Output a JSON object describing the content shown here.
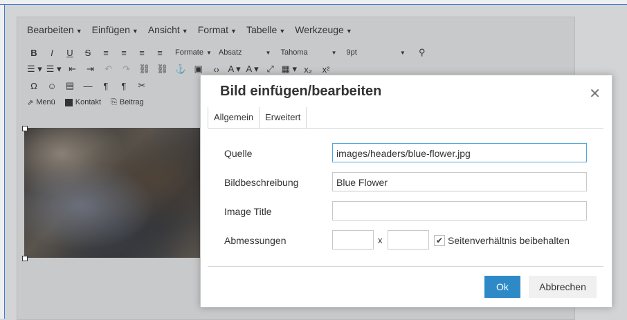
{
  "menubar": {
    "items": [
      "Bearbeiten",
      "Einfügen",
      "Ansicht",
      "Format",
      "Tabelle",
      "Werkzeuge"
    ]
  },
  "toolbar": {
    "bold": "B",
    "italic": "I",
    "underline": "U",
    "strike": "S",
    "formats_label": "Formate",
    "paragraph_label": "Absatz",
    "font_label": "Tahoma",
    "size_label": "9pt",
    "link_menu": "Menü",
    "link_contact": "Kontakt",
    "link_post": "Beitrag"
  },
  "dialog": {
    "title": "Bild einfügen/bearbeiten",
    "tabs": [
      "Allgemein",
      "Erweitert"
    ],
    "fields": {
      "source_label": "Quelle",
      "source_value": "images/headers/blue-flower.jpg",
      "description_label": "Bildbeschreibung",
      "description_value": "Blue Flower",
      "title_label": "Image Title",
      "title_value": "",
      "dimensions_label": "Abmessungen",
      "dimensions_separator": "x",
      "keep_ratio_label": "Seitenverhältnis beibehalten"
    },
    "ok_label": "Ok",
    "cancel_label": "Abbrechen"
  }
}
